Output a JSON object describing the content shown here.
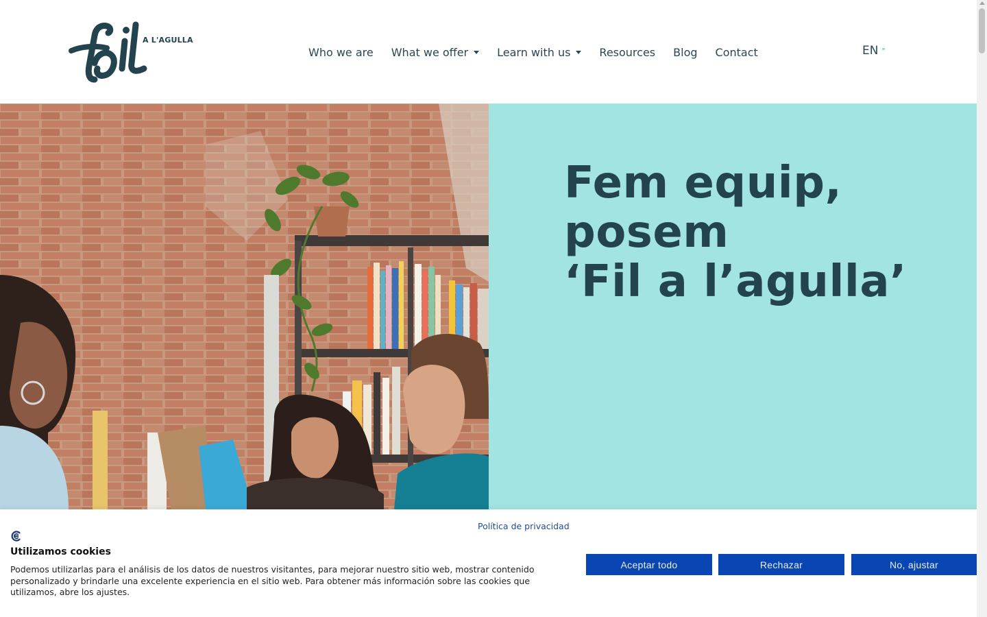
{
  "header": {
    "logo_alt": "fil A L'AGULLA",
    "logo_tagline": "A L'AGULLA",
    "nav": [
      {
        "label": "Who we are",
        "dropdown": false
      },
      {
        "label": "What we offer",
        "dropdown": true
      },
      {
        "label": "Learn with us",
        "dropdown": true
      },
      {
        "label": "Resources",
        "dropdown": false
      },
      {
        "label": "Blog",
        "dropdown": false
      },
      {
        "label": "Contact",
        "dropdown": false
      }
    ],
    "language": "EN"
  },
  "hero": {
    "title_line1": "Fem equip,",
    "title_line2": "posem",
    "title_line3": "‘Fil a l’agulla’",
    "panel_color": "#a1e4e1",
    "text_color": "#23434f"
  },
  "cookie_banner": {
    "privacy_link": "Política de privacidad",
    "title": "Utilizamos cookies",
    "text": "Podemos utilizarlas para el análisis de los datos de nuestros visitantes, para mejorar nuestro sitio web, mostrar contenido personalizado y brindarle una excelente experiencia en el sitio web. Para obtener más información sobre las cookies que utilizamos, abre los ajustes.",
    "buttons": {
      "accept": "Aceptar todo",
      "reject": "Rechazar",
      "adjust": "No, ajustar"
    },
    "button_color": "#0945b3"
  }
}
